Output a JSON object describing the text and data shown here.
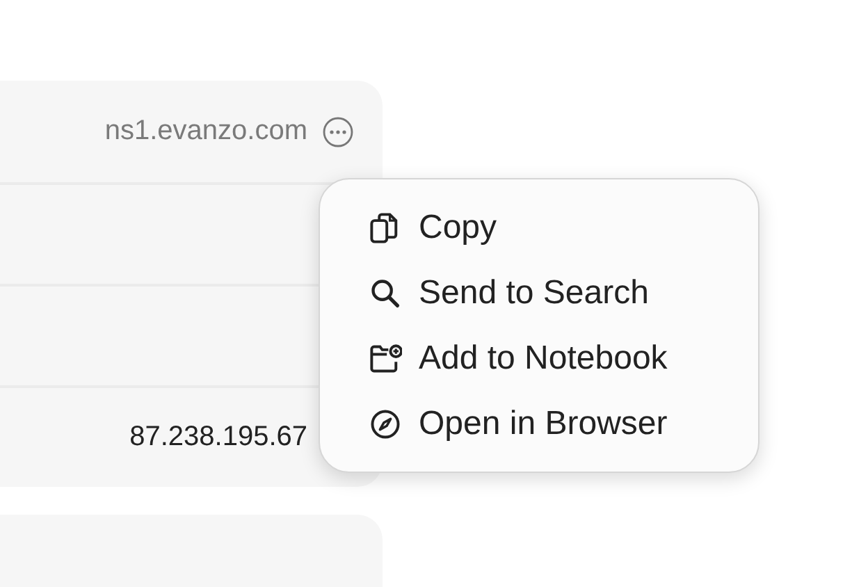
{
  "records": [
    {
      "kind": "link",
      "value": "ns1.evanzo.com"
    },
    {
      "kind": "blank"
    },
    {
      "kind": "blank"
    },
    {
      "kind": "address",
      "value": "87.238.195.67"
    }
  ],
  "context_menu": {
    "items": [
      {
        "label": "Copy",
        "kind": "copy"
      },
      {
        "label": "Send to Search",
        "kind": "search"
      },
      {
        "label": "Add to Notebook",
        "kind": "notebook"
      },
      {
        "label": "Open in Browser",
        "kind": "browser"
      }
    ]
  }
}
